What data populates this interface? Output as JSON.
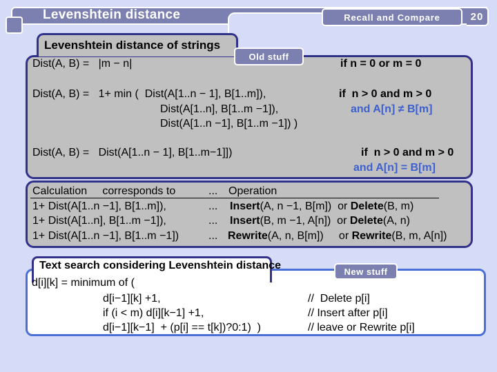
{
  "header": {
    "title": "Levenshtein distance",
    "section": "Recall and Compare",
    "page_number": "20"
  },
  "old_panel": {
    "tab_title": "Levenshtein distance of strings",
    "badge": "Old stuff",
    "cases": [
      {
        "formula_lines": [
          "Dist(A, B) =   |m − n|"
        ],
        "condition": "if n = 0 or m = 0",
        "condition_extra": ""
      },
      {
        "formula_lines": [
          "Dist(A, B) =   1+ min (  Dist(A[1..n − 1], B[1..m]),",
          "Dist(A[1..n], B[1..m −1]),",
          "Dist(A[1..n −1], B[1..m −1]) )"
        ],
        "condition": "if  n > 0 and m > 0",
        "condition_extra": "and A[n] ≠ B[m]"
      },
      {
        "formula_lines": [
          "Dist(A, B) =   Dist(A[1..n − 1], B[1..m−1]])"
        ],
        "condition": "if  n > 0 and m > 0",
        "condition_extra": "and A[n] = B[m]"
      }
    ]
  },
  "table": {
    "headers": [
      "Calculation     corresponds to",
      "...",
      "Operation"
    ],
    "rows": [
      {
        "calc": "1+ Dist(A[1..n −1], B[1..m]),",
        "dots": "...",
        "op1_name": "Insert",
        "op1_args": "(A, n −1, B[m])",
        "or": "  or ",
        "op2_name": "Delete",
        "op2_args": "(B, m)"
      },
      {
        "calc": "1+ Dist(A[1..n], B[1..m −1]),",
        "dots": "...",
        "op1_name": "Insert",
        "op1_args": "(B, m −1, A[n])",
        "or": "  or ",
        "op2_name": "Delete",
        "op2_args": "(A, n)"
      },
      {
        "calc": "1+ Dist(A[1..n −1], B[1..m −1])",
        "dots": "...",
        "op1_name": "Rewrite",
        "op1_args": "(A, n, B[m])",
        "or": "     or ",
        "op2_name": "Rewrite",
        "op2_args": "(B, m, A[n])"
      }
    ]
  },
  "new_panel": {
    "tab_title": "Text search considering Levenshtein distance",
    "badge": "New stuff",
    "intro": "d[i][k] = minimum of (",
    "lines": [
      {
        "code": "d[i−1][k] +1,",
        "comment": "//  Delete p[i]"
      },
      {
        "code": "if (i < m) d[i][k−1] +1,",
        "comment": "// Insert after p[i]"
      },
      {
        "code": "d[i−1][k−1]  + (p[i] == t[k])?0:1)  )",
        "comment": "// leave or Rewrite p[i]"
      }
    ]
  },
  "colors": {
    "header_fill": "#7b80b0",
    "panel_gray": "#c0c0c0",
    "panel_border": "#31318a",
    "accent_blue": "#3d60d0",
    "new_border": "#4a6fd8",
    "background": "#d6dcf8"
  }
}
